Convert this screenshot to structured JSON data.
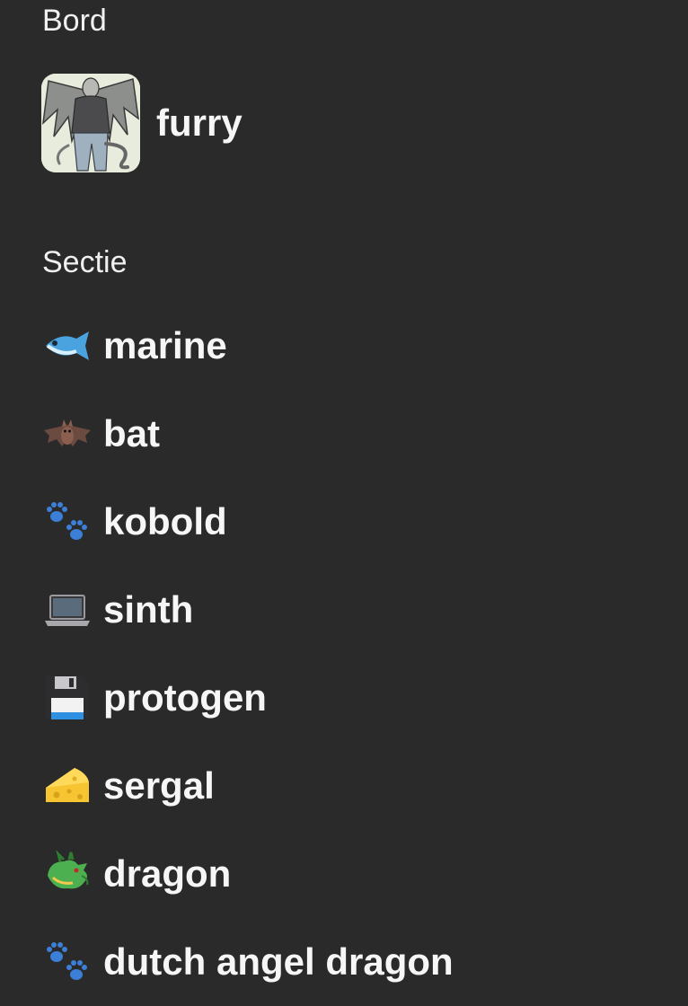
{
  "board_heading": "Bord",
  "board": {
    "name": "furry",
    "thumbnail": "winged-character-illustration"
  },
  "section_heading": "Sectie",
  "sections": [
    {
      "label": "marine",
      "icon": "fish-icon"
    },
    {
      "label": "bat",
      "icon": "bat-icon"
    },
    {
      "label": "kobold",
      "icon": "paw-prints-icon"
    },
    {
      "label": "sinth",
      "icon": "laptop-icon"
    },
    {
      "label": "protogen",
      "icon": "floppy-disk-icon"
    },
    {
      "label": "sergal",
      "icon": "cheese-icon"
    },
    {
      "label": "dragon",
      "icon": "dragon-icon"
    },
    {
      "label": "dutch angel dragon",
      "icon": "paw-prints-icon"
    }
  ]
}
